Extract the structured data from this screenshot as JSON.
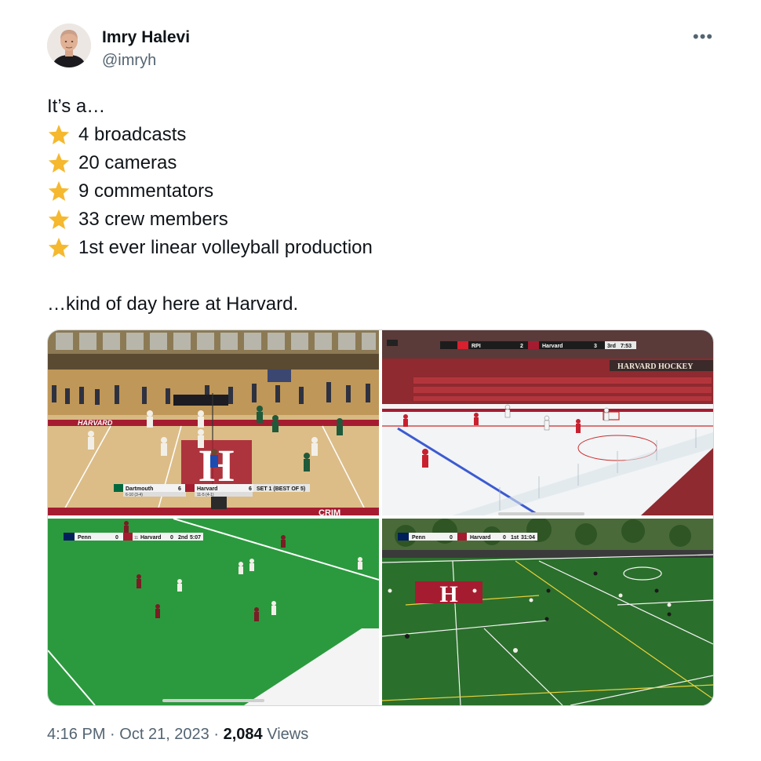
{
  "author": {
    "name": "Imry Halevi",
    "handle": "@imryh"
  },
  "tweet": {
    "intro": "It’s a…",
    "items": [
      "4 broadcasts",
      "20 cameras",
      "9 commentators",
      "33 crew members",
      "1st ever linear volleyball production"
    ],
    "outro": "…kind of day here at Harvard.",
    "star_icon": "star-emoji",
    "star_color": "#f5b82e"
  },
  "media": {
    "volleyball": {
      "banner": "HARVARD",
      "floor_text": "CRIM",
      "team1": "Dartmouth",
      "team1_score": "6",
      "team1_record": "6-10 (3-4)",
      "team2": "Harvard",
      "team2_score": "6",
      "team2_record": "11-5 (4-1)",
      "set": "SET 1 (BEST OF 5)"
    },
    "hockey": {
      "team1": "RPI",
      "team1_score": "2",
      "team2": "Harvard",
      "team2_score": "3",
      "period": "3rd",
      "clock": "7:53",
      "banner": "HARVARD HOCKEY"
    },
    "field_hockey": {
      "team1": "Penn",
      "team1_score": "0",
      "team2": "Harvard",
      "team2_score": "0",
      "team2_rank": "11",
      "period": "2nd",
      "clock": "5:07"
    },
    "soccer": {
      "team1": "Penn",
      "team1_score": "0",
      "team2": "Harvard",
      "team2_score": "0",
      "period": "1st",
      "clock": "31:04"
    }
  },
  "footer": {
    "time": "4:16 PM",
    "separator": "·",
    "date": "Oct 21, 2023",
    "views_count": "2,084",
    "views_label": "Views"
  },
  "colors": {
    "harvard_crimson": "#a51c30",
    "dartmouth_green": "#00693e",
    "penn_blue": "#011f5b",
    "text_primary": "#0f1419",
    "text_secondary": "#536471"
  }
}
